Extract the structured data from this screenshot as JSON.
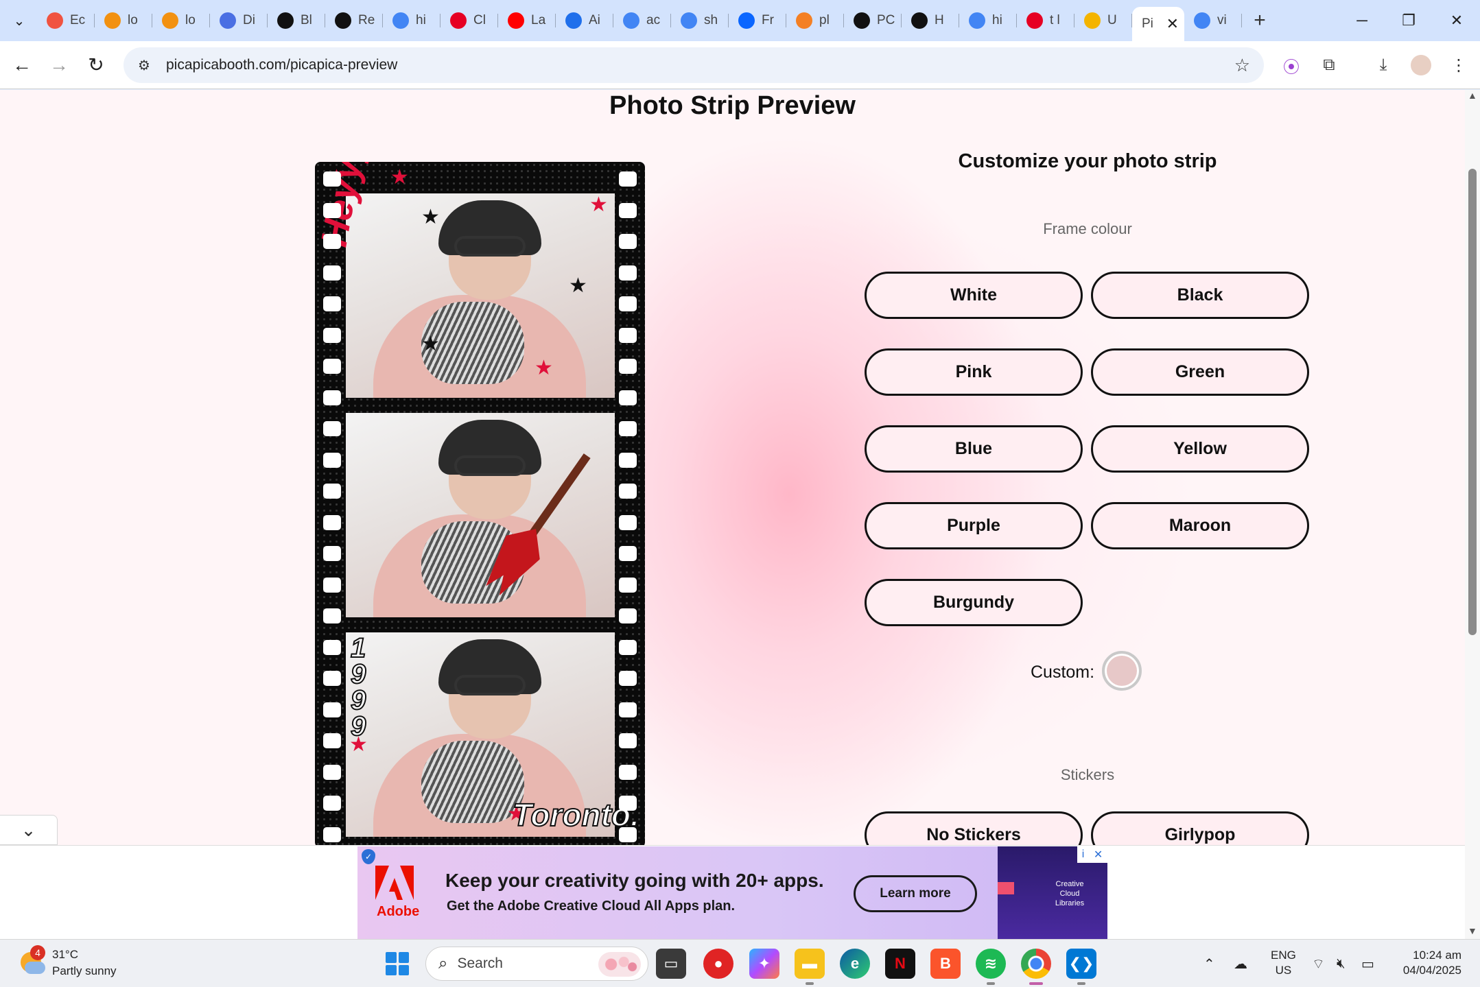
{
  "browser": {
    "tabs": [
      {
        "label": "Ec",
        "icon": "laravel-icon",
        "color": "#f05340"
      },
      {
        "label": "lo",
        "icon": "phpmyadmin-icon",
        "color": "#f29111"
      },
      {
        "label": "lo",
        "icon": "phpmyadmin-icon",
        "color": "#f29111"
      },
      {
        "label": "Di",
        "icon": "dribbble-icon",
        "color": "#4a6fe3"
      },
      {
        "label": "Bl",
        "icon": "bl-icon",
        "color": "#111111"
      },
      {
        "label": "Re",
        "icon": "openai-icon",
        "color": "#111111"
      },
      {
        "label": "hi",
        "icon": "google-icon",
        "color": "#4285f4"
      },
      {
        "label": "Cl",
        "icon": "pinterest-icon",
        "color": "#e60023"
      },
      {
        "label": "La",
        "icon": "youtube-icon",
        "color": "#ff0000"
      },
      {
        "label": "Ai",
        "icon": "layers-icon",
        "color": "#1f6feb"
      },
      {
        "label": "ac",
        "icon": "google-icon",
        "color": "#4285f4"
      },
      {
        "label": "sh",
        "icon": "google-icon",
        "color": "#4285f4"
      },
      {
        "label": "Fr",
        "icon": "framer-icon",
        "color": "#0a66ff"
      },
      {
        "label": "pl",
        "icon": "stackoverflow-icon",
        "color": "#f48024"
      },
      {
        "label": "PC",
        "icon": "github-icon",
        "color": "#111111"
      },
      {
        "label": "H",
        "icon": "github-icon",
        "color": "#111111"
      },
      {
        "label": "hi",
        "icon": "google-icon",
        "color": "#4285f4"
      },
      {
        "label": "t l",
        "icon": "pinterest-icon",
        "color": "#e60023"
      },
      {
        "label": "U",
        "icon": "graduation-cap-icon",
        "color": "#f4b400"
      },
      {
        "label": "Pi",
        "icon": "",
        "color": "#ffffff",
        "active": true
      },
      {
        "label": "vi",
        "icon": "google-icon",
        "color": "#4285f4"
      }
    ],
    "url": "picapicabooth.com/picapica-preview"
  },
  "page": {
    "title": "Photo Strip Preview",
    "customize_title": "Customize your photo strip",
    "frame_colour_label": "Frame colour",
    "frame_colours": [
      "White",
      "Black",
      "Pink",
      "Green",
      "Blue",
      "Yellow",
      "Purple",
      "Maroon",
      "Burgundy"
    ],
    "custom_label": "Custom:",
    "custom_colour": "#e7c8c8",
    "stickers_label": "Stickers",
    "sticker_options": [
      "No Stickers",
      "Girlypop"
    ],
    "strip_frame_colour": "#0a0a0a",
    "strip_stickers": {
      "top_text": "Heyyy Toronto",
      "year": "1999",
      "bottom_text": "Toronto."
    }
  },
  "ad": {
    "brand": "Adobe",
    "headline": "Keep your creativity going with 20+ apps.",
    "subline": "Get the Adobe Creative Cloud All Apps plan.",
    "cta": "Learn more",
    "tile_text": "Creative Cloud Libraries",
    "adchoices": "i",
    "close": "✕"
  },
  "taskbar": {
    "weather_temp": "31°C",
    "weather_desc": "Partly sunny",
    "weather_badge": "4",
    "search_placeholder": "Search",
    "lang_line1": "ENG",
    "lang_line2": "US",
    "time": "10:24 am",
    "date": "04/04/2025"
  }
}
